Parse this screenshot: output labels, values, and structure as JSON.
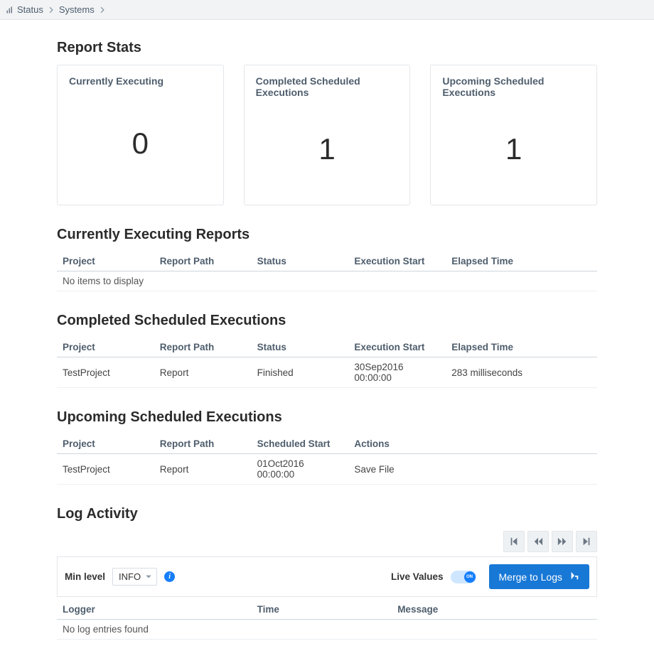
{
  "breadcrumb": {
    "item1": "Status",
    "item2": "Systems"
  },
  "sections": {
    "report_stats_title": "Report Stats",
    "currently_executing_reports_title": "Currently Executing Reports",
    "completed_scheduled_title": "Completed Scheduled Executions",
    "upcoming_scheduled_title": "Upcoming Scheduled Executions",
    "log_activity_title": "Log Activity"
  },
  "cards": [
    {
      "title": "Currently Executing",
      "value": "0"
    },
    {
      "title": "Completed Scheduled Executions",
      "value": "1"
    },
    {
      "title": "Upcoming Scheduled Executions",
      "value": "1"
    }
  ],
  "tables": {
    "currently_executing": {
      "headers": [
        "Project",
        "Report Path",
        "Status",
        "Execution Start",
        "Elapsed Time"
      ],
      "empty_msg": "No items to display"
    },
    "completed": {
      "headers": [
        "Project",
        "Report Path",
        "Status",
        "Execution Start",
        "Elapsed Time"
      ],
      "rows": [
        {
          "project": "TestProject",
          "report_path": "Report",
          "status": "Finished",
          "start": "30Sep2016 00:00:00",
          "elapsed": "283 milliseconds"
        }
      ]
    },
    "upcoming": {
      "headers": [
        "Project",
        "Report Path",
        "Scheduled Start",
        "Actions"
      ],
      "rows": [
        {
          "project": "TestProject",
          "report_path": "Report",
          "start": "01Oct2016 00:00:00",
          "actions": "Save File"
        }
      ]
    },
    "log_activity": {
      "headers": [
        "Logger",
        "Time",
        "Message"
      ],
      "empty_msg": "No log entries found"
    }
  },
  "log_filter": {
    "min_level_label": "Min level",
    "min_level_value": "INFO",
    "live_values_label": "Live Values",
    "live_values_on": true,
    "toggle_text": "ON",
    "merge_button_label": "Merge to Logs"
  }
}
